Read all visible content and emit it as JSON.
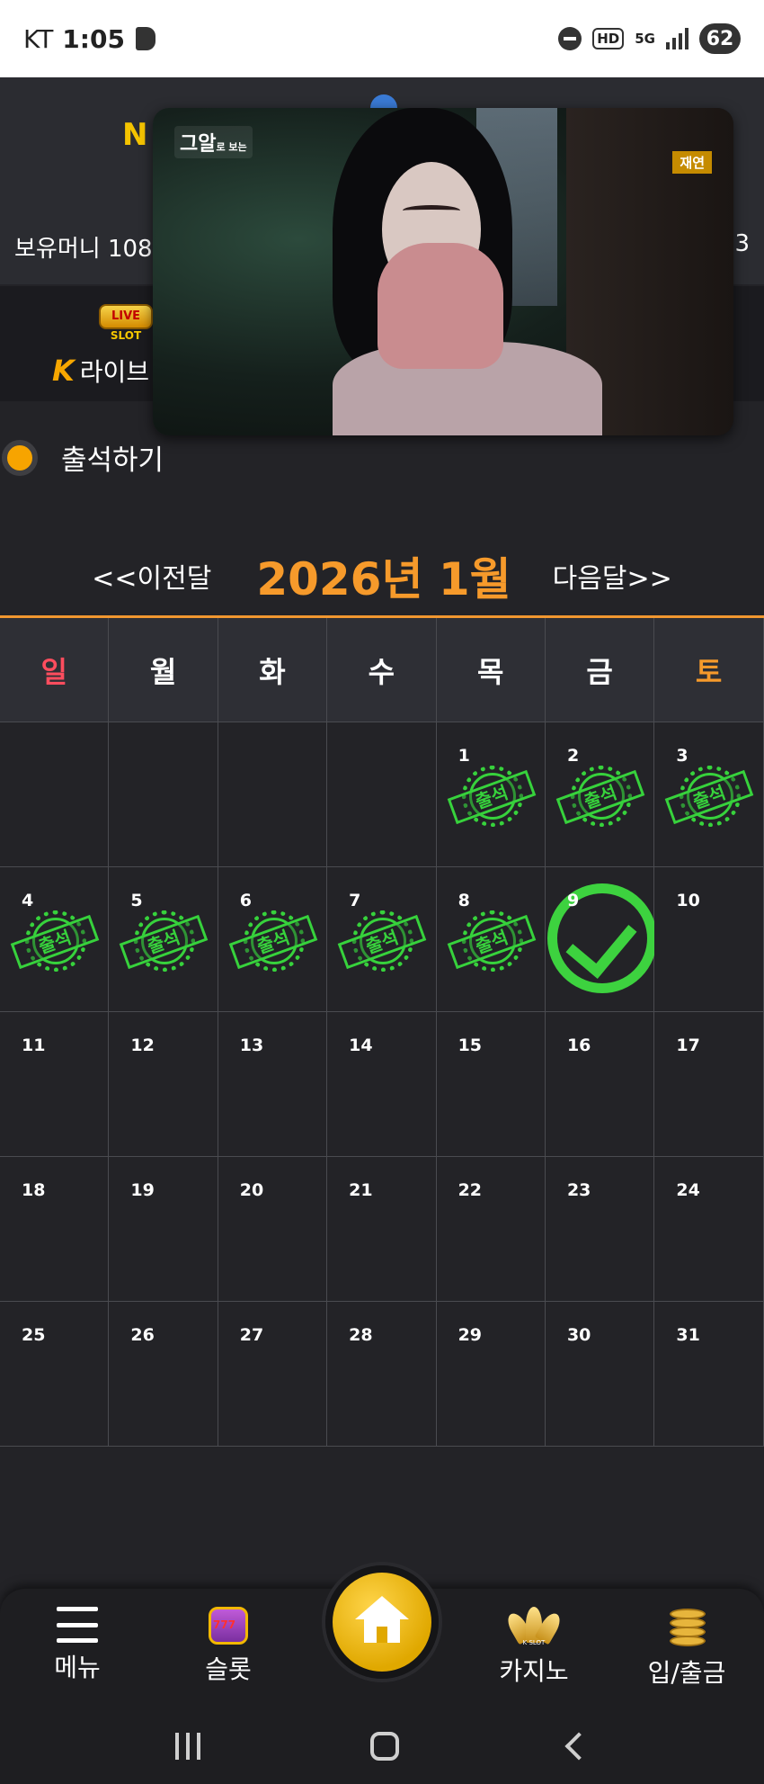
{
  "status_bar": {
    "carrier": "KT",
    "time": "1:05",
    "hd": "HD",
    "network": "5G",
    "battery": "62"
  },
  "header": {
    "logo_fragment": "N",
    "balance_text": "보유머니 108",
    "balance_right": "3"
  },
  "categories": {
    "slot_badge": "LIVE",
    "slot_caption": "SLOT",
    "live_label": "라이브"
  },
  "video": {
    "channel_logo": "그알",
    "channel_logo_small": "로 보는",
    "badge": "재연"
  },
  "attendance": {
    "label": "출석하기"
  },
  "month_nav": {
    "prev": "<<이전달",
    "title": "2026년 1월",
    "next": "다음달>>"
  },
  "calendar": {
    "weekdays": [
      "일",
      "월",
      "화",
      "수",
      "목",
      "금",
      "토"
    ],
    "stamp_label": "출석",
    "today": 9,
    "attended_days": [
      1,
      2,
      3,
      4,
      5,
      6,
      7,
      8
    ],
    "leading_blanks": 4,
    "days_in_month": 31
  },
  "bottom_nav": {
    "menu": "메뉴",
    "slot": "슬롯",
    "casino": "카지노",
    "casino_icon_text": "K SLOT",
    "deposit": "입/출금"
  },
  "colors": {
    "accent": "#f69a2b",
    "stamp_green": "#37d23c",
    "sunday_red": "#ff4d5e",
    "home_gold": "#f2b800"
  }
}
